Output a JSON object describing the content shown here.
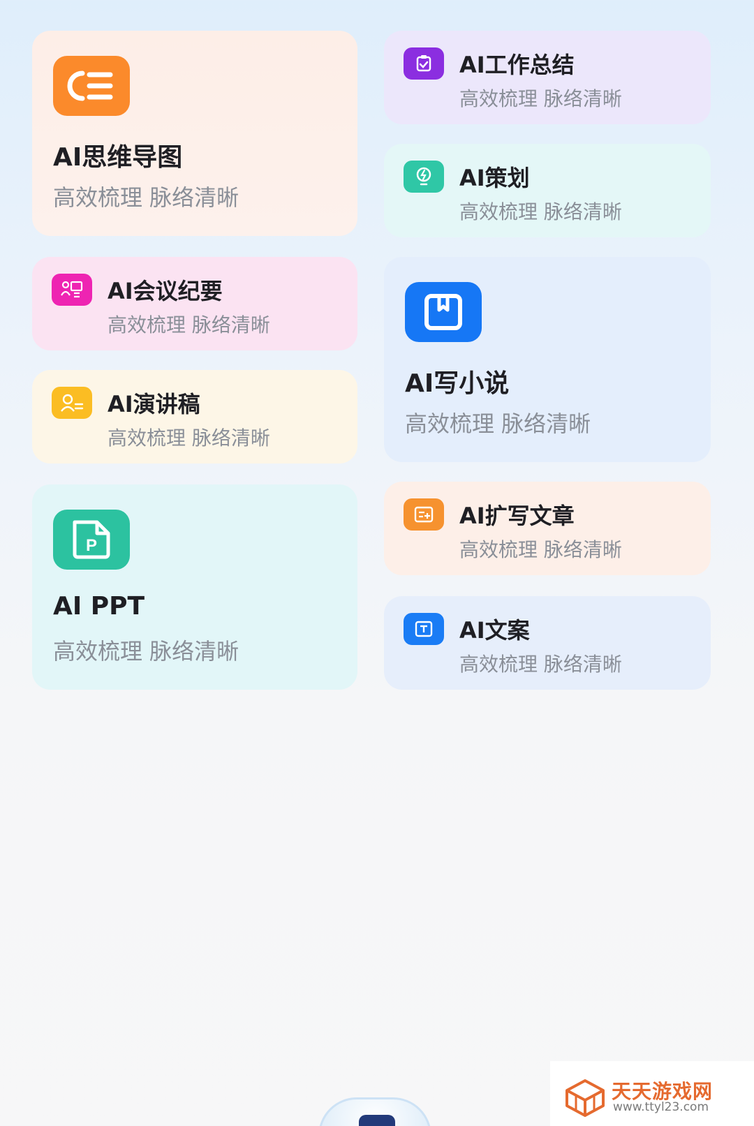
{
  "colors": {
    "mindmap": "#fb8a2b",
    "worksummary": "#8b2ee0",
    "planning": "#2fc7a6",
    "meeting": "#ee24b2",
    "speech": "#fbbd23",
    "novel": "#1677f5",
    "ppt": "#2cc2a0",
    "expand": "#f6922f",
    "copywriting": "#1a7cf5",
    "watermark": "#e56a2f"
  },
  "cards": {
    "mindmap": {
      "title": "AI思维导图",
      "subtitle": "高效梳理 脉络清晰",
      "icon": "list-icon"
    },
    "worksummary": {
      "title": "AI工作总结",
      "subtitle": "高效梳理 脉络清晰",
      "icon": "clipboard-check-icon"
    },
    "planning": {
      "title": "AI策划",
      "subtitle": "高效梳理 脉络清晰",
      "icon": "lightbulb-icon"
    },
    "meeting": {
      "title": "AI会议纪要",
      "subtitle": "高效梳理 脉络清晰",
      "icon": "presentation-icon"
    },
    "speech": {
      "title": "AI演讲稿",
      "subtitle": "高效梳理 脉络清晰",
      "icon": "speaker-icon"
    },
    "novel": {
      "title": "AI写小说",
      "subtitle": "高效梳理 脉络清晰",
      "icon": "book-bookmark-icon"
    },
    "ppt": {
      "title": "AI PPT",
      "subtitle": "高效梳理 脉络清晰",
      "icon": "ppt-file-icon"
    },
    "expand": {
      "title": "AI扩写文章",
      "subtitle": "高效梳理 脉络清晰",
      "icon": "document-plus-icon"
    },
    "copywriting": {
      "title": "AI文案",
      "subtitle": "高效梳理 脉络清晰",
      "icon": "text-box-icon"
    }
  },
  "watermark": {
    "name": "天天游戏网",
    "url": "www.ttyl23.com"
  }
}
